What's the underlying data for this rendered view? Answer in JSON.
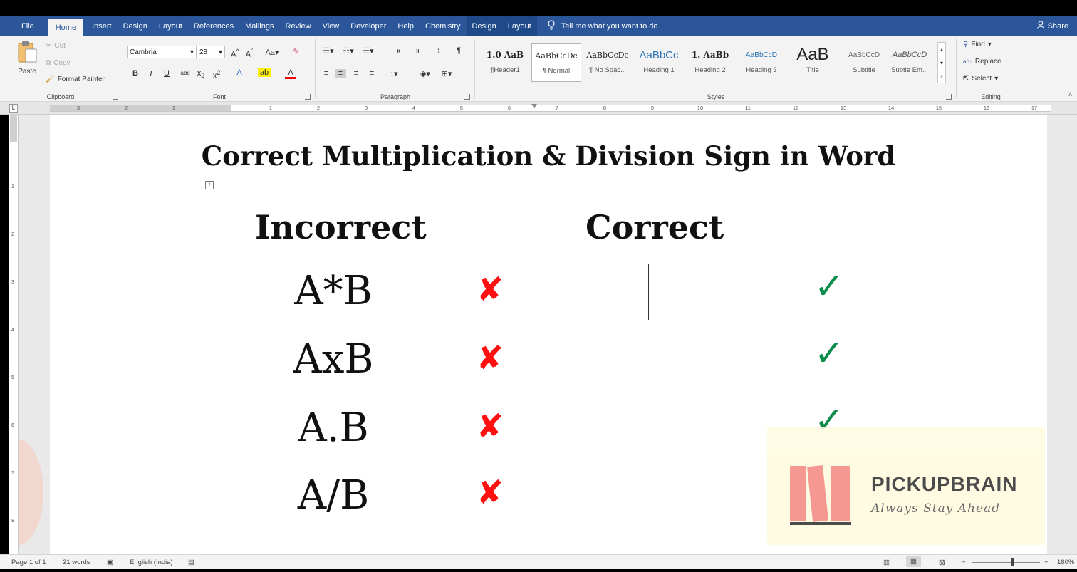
{
  "menu": {
    "tabs": [
      "File",
      "Home",
      "Insert",
      "Design",
      "Layout",
      "References",
      "Mailings",
      "Review",
      "View",
      "Developer",
      "Help",
      "Chemistry"
    ],
    "context_tabs": [
      "Design",
      "Layout"
    ],
    "tell_me": "Tell me what you want to do",
    "share": "Share"
  },
  "clipboard": {
    "paste": "Paste",
    "cut": "Cut",
    "copy": "Copy",
    "format_painter": "Format Painter",
    "label": "Clipboard"
  },
  "font": {
    "name": "Cambria",
    "size": "28",
    "label": "Font"
  },
  "paragraph": {
    "label": "Paragraph"
  },
  "styles": {
    "label": "Styles",
    "items": [
      {
        "sample": "1.0 AaB",
        "name": "¶Header1"
      },
      {
        "sample": "AaBbCcDc",
        "name": "¶ Normal"
      },
      {
        "sample": "AaBbCcDc",
        "name": "¶ No Spac..."
      },
      {
        "sample": "AaBbCc",
        "name": "Heading 1"
      },
      {
        "sample": "1. AaBb",
        "name": "Heading 2"
      },
      {
        "sample": "AaBbCcD",
        "name": "Heading 3"
      },
      {
        "sample": "AaB",
        "name": "Title"
      },
      {
        "sample": "AaBbCcD",
        "name": "Subtitle"
      },
      {
        "sample": "AaBbCcD",
        "name": "Subtle Em..."
      }
    ]
  },
  "editing": {
    "find": "Find",
    "replace": "Replace",
    "select": "Select",
    "label": "Editing"
  },
  "ruler": {
    "left_numbers": [
      "3",
      "2",
      "1"
    ],
    "right_numbers": [
      "1",
      "2",
      "3",
      "4",
      "5",
      "6",
      "7",
      "8",
      "9",
      "10",
      "11",
      "12",
      "13",
      "14",
      "15",
      "16",
      "17"
    ],
    "vertical_numbers": [
      "1",
      "2",
      "3",
      "4",
      "5",
      "6",
      "7",
      "8"
    ]
  },
  "document": {
    "title": "Correct Multiplication & Division Sign in Word",
    "col_incorrect": "Incorrect",
    "col_correct": "Correct",
    "rows": [
      {
        "expr": "A*B",
        "mark": "✘",
        "check": "✓"
      },
      {
        "expr": "AxB",
        "mark": "✘",
        "check": "✓"
      },
      {
        "expr": "A.B",
        "mark": "✘",
        "check": "✓"
      },
      {
        "expr": "A/B",
        "mark": "✘",
        "check": ""
      }
    ]
  },
  "watermark": {
    "name": "PICKUPBRAIN",
    "tagline": "Always Stay Ahead"
  },
  "status": {
    "page": "Page 1 of 1",
    "words": "21 words",
    "language": "English (India)",
    "zoom": "180%"
  },
  "colors": {
    "ribbon_blue": "#2b579a",
    "cross_red": "#ff0f0f",
    "check_green": "#0a8c4a"
  }
}
